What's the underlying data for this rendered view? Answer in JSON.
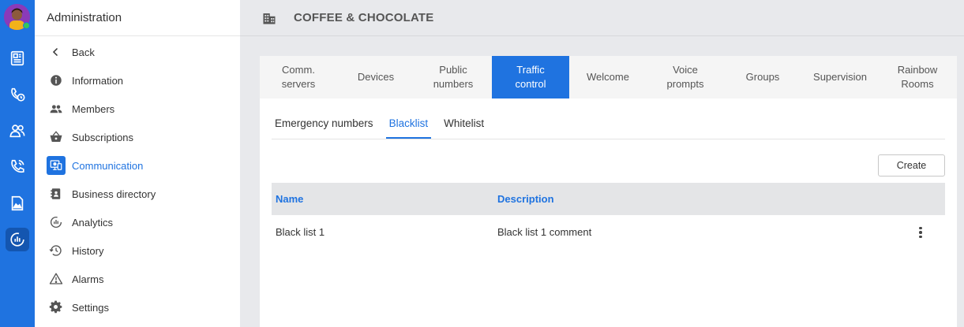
{
  "admin": {
    "title": "Administration"
  },
  "nav": [
    {
      "label": "Back",
      "icon": "chevron-left-icon"
    },
    {
      "label": "Information",
      "icon": "info-icon"
    },
    {
      "label": "Members",
      "icon": "members-icon"
    },
    {
      "label": "Subscriptions",
      "icon": "basket-icon"
    },
    {
      "label": "Communication",
      "icon": "communication-icon",
      "active": true
    },
    {
      "label": "Business directory",
      "icon": "directory-icon"
    },
    {
      "label": "Analytics",
      "icon": "analytics-icon"
    },
    {
      "label": "History",
      "icon": "history-icon"
    },
    {
      "label": "Alarms",
      "icon": "alarm-icon"
    },
    {
      "label": "Settings",
      "icon": "gear-icon"
    }
  ],
  "header": {
    "company": "COFFEE & CHOCOLATE"
  },
  "main_tabs": [
    {
      "label": "Comm.\nservers"
    },
    {
      "label": "Devices"
    },
    {
      "label": "Public\nnumbers"
    },
    {
      "label": "Traffic\ncontrol",
      "active": true
    },
    {
      "label": "Welcome"
    },
    {
      "label": "Voice\nprompts"
    },
    {
      "label": "Groups"
    },
    {
      "label": "Supervision"
    },
    {
      "label": "Rainbow\nRooms"
    }
  ],
  "sub_tabs": [
    {
      "label": "Emergency numbers"
    },
    {
      "label": "Blacklist",
      "active": true
    },
    {
      "label": "Whitelist"
    }
  ],
  "create_label": "Create",
  "table": {
    "columns": [
      "Name",
      "Description"
    ],
    "rows": [
      {
        "name": "Black list 1",
        "description": "Black list 1 comment"
      }
    ]
  },
  "colors": {
    "accent": "#1f73e0",
    "rail": "#1f73e0"
  }
}
